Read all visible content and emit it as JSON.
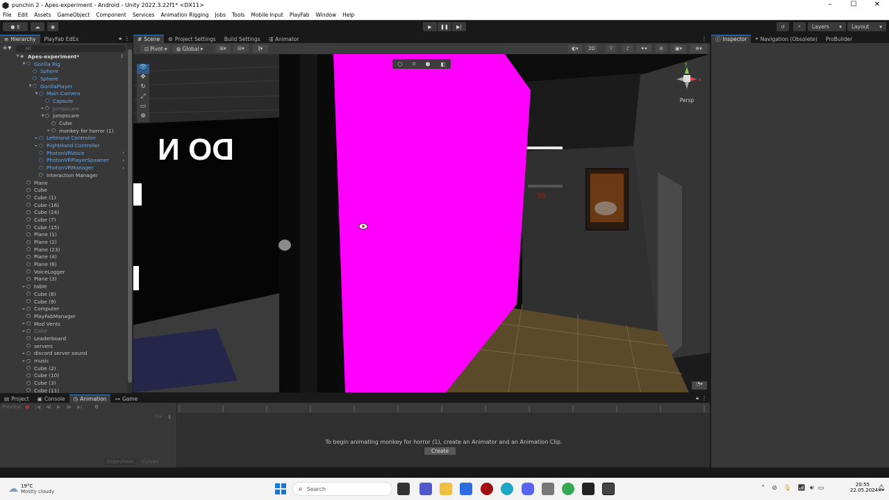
{
  "window": {
    "title": "punchin 2 - Apes-experiment - Android - Unity 2022.3.22f1* <DX11>",
    "controls": [
      "–",
      "☐",
      "✕"
    ]
  },
  "menu": [
    "File",
    "Edit",
    "Assets",
    "GameObject",
    "Component",
    "Services",
    "Animation Rigging",
    "Jobs",
    "Tools",
    "Mobile Input",
    "PlayFab",
    "Window",
    "Help"
  ],
  "toolbar": {
    "account_label": "E",
    "layers_label": "Layers",
    "layout_label": "Layout"
  },
  "hierarchy": {
    "tabs": [
      "Hierarchy",
      "PlayFab EdEx"
    ],
    "search_placeholder": "All",
    "scene_name": "Apes-experiment*",
    "items": [
      {
        "label": "Gorilla Rig",
        "indent": 1,
        "type": "prefab",
        "arrow": "▼"
      },
      {
        "label": "Sphere",
        "indent": 2,
        "type": "prefab",
        "arrow": ""
      },
      {
        "label": "Sphere",
        "indent": 2,
        "type": "prefab",
        "arrow": ""
      },
      {
        "label": "GorillaPlayer",
        "indent": 2,
        "type": "prefab",
        "arrow": "▼"
      },
      {
        "label": "Main Camera",
        "indent": 3,
        "type": "prefab",
        "arrow": "▼"
      },
      {
        "label": "Capsule",
        "indent": 4,
        "type": "prefab",
        "arrow": ""
      },
      {
        "label": "Jumpscare",
        "indent": 4,
        "type": "disabled",
        "arrow": "►"
      },
      {
        "label": "jumpscare",
        "indent": 4,
        "type": "normal",
        "arrow": "▼"
      },
      {
        "label": "Cube",
        "indent": 5,
        "type": "normal",
        "arrow": ""
      },
      {
        "label": "monkey for horror (1)",
        "indent": 5,
        "type": "normal",
        "arrow": "►"
      },
      {
        "label": "LeftHand Controller",
        "indent": 3,
        "type": "prefab",
        "arrow": "►"
      },
      {
        "label": "RightHand Controller",
        "indent": 3,
        "type": "prefab",
        "arrow": "►"
      },
      {
        "label": "PhotonVRVoice",
        "indent": 3,
        "type": "prefab",
        "arrow": ""
      },
      {
        "label": "PhotonVRPlayerSpawner",
        "indent": 3,
        "type": "prefab",
        "arrow": ""
      },
      {
        "label": "PhotonVRManager",
        "indent": 3,
        "type": "prefab",
        "arrow": ""
      },
      {
        "label": "Interaction Manager",
        "indent": 3,
        "type": "normal",
        "arrow": ""
      },
      {
        "label": "Plane",
        "indent": 1,
        "type": "normal",
        "arrow": ""
      },
      {
        "label": "Cube",
        "indent": 1,
        "type": "normal",
        "arrow": ""
      },
      {
        "label": "Cube (1)",
        "indent": 1,
        "type": "normal",
        "arrow": ""
      },
      {
        "label": "Cube (16)",
        "indent": 1,
        "type": "normal",
        "arrow": ""
      },
      {
        "label": "Cube (24)",
        "indent": 1,
        "type": "normal",
        "arrow": ""
      },
      {
        "label": "Cube (7)",
        "indent": 1,
        "type": "normal",
        "arrow": ""
      },
      {
        "label": "Cube (15)",
        "indent": 1,
        "type": "normal",
        "arrow": ""
      },
      {
        "label": "Plane (1)",
        "indent": 1,
        "type": "normal",
        "arrow": ""
      },
      {
        "label": "Plane (2)",
        "indent": 1,
        "type": "normal",
        "arrow": ""
      },
      {
        "label": "Plane (23)",
        "indent": 1,
        "type": "normal",
        "arrow": ""
      },
      {
        "label": "Plane (4)",
        "indent": 1,
        "type": "normal",
        "arrow": ""
      },
      {
        "label": "Plane (6)",
        "indent": 1,
        "type": "normal",
        "arrow": ""
      },
      {
        "label": "VoiceLogger",
        "indent": 1,
        "type": "normal",
        "arrow": ""
      },
      {
        "label": "Plane (3)",
        "indent": 1,
        "type": "normal",
        "arrow": ""
      },
      {
        "label": "table",
        "indent": 1,
        "type": "normal",
        "arrow": "►"
      },
      {
        "label": "Cube (8)",
        "indent": 1,
        "type": "normal",
        "arrow": ""
      },
      {
        "label": "Cube (9)",
        "indent": 1,
        "type": "normal",
        "arrow": ""
      },
      {
        "label": "Computer",
        "indent": 1,
        "type": "normal",
        "arrow": "►"
      },
      {
        "label": "PlayFabManager",
        "indent": 1,
        "type": "normal",
        "arrow": ""
      },
      {
        "label": "Mod Vents",
        "indent": 1,
        "type": "normal",
        "arrow": "►"
      },
      {
        "label": "Color",
        "indent": 1,
        "type": "disabled",
        "arrow": "►"
      },
      {
        "label": "Leaderboard",
        "indent": 1,
        "type": "normal",
        "arrow": ""
      },
      {
        "label": "servers",
        "indent": 1,
        "type": "normal",
        "arrow": ""
      },
      {
        "label": "discord server sound",
        "indent": 1,
        "type": "normal",
        "arrow": "►"
      },
      {
        "label": "music",
        "indent": 1,
        "type": "normal",
        "arrow": "►"
      },
      {
        "label": "Cube (2)",
        "indent": 1,
        "type": "normal",
        "arrow": ""
      },
      {
        "label": "Cube (10)",
        "indent": 1,
        "type": "normal",
        "arrow": ""
      },
      {
        "label": "Cube (3)",
        "indent": 1,
        "type": "normal",
        "arrow": ""
      },
      {
        "label": "Cube (11)",
        "indent": 1,
        "type": "normal",
        "arrow": ""
      }
    ]
  },
  "scene": {
    "tabs": [
      "Scene",
      "Project Settings",
      "Build Settings",
      "Animator"
    ],
    "pivot_label": "Pivot",
    "global_label": "Global",
    "mode_2d_label": "2D",
    "persp_label": "Persp",
    "wall_text": "DO N",
    "gizmo_y": "y",
    "gizmo_x": "x",
    "colors": {
      "magenta": "#ff00ff",
      "floor": "#5a4a2a"
    }
  },
  "inspector": {
    "tabs": [
      "Inspector",
      "Navigation (Obsolete)",
      "ProBuilder"
    ]
  },
  "bottom": {
    "tabs": [
      "Project",
      "Console",
      "Animation",
      "Game"
    ],
    "preview_label": "Preview",
    "frame_value": "0",
    "dopesheet_label": "Dopesheet",
    "curves_label": "Curves",
    "message": "To begin animating monkey for horror (1), create an Animator and an Animation Clip.",
    "create_label": "Create"
  },
  "taskbar": {
    "weather_temp": "19°C",
    "weather_desc": "Mostly cloudy",
    "search_placeholder": "Search",
    "time": "20:55",
    "date": "22.05.2024"
  }
}
